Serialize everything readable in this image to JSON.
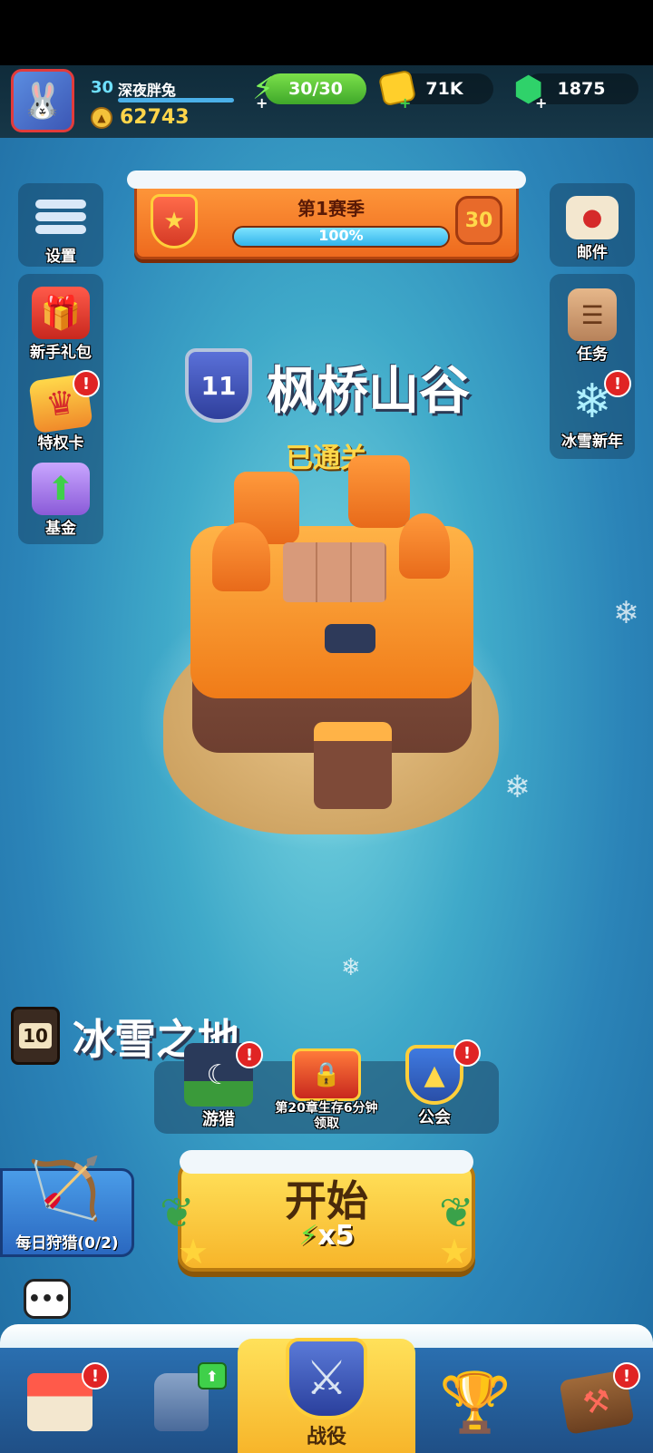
{
  "player": {
    "level": "30",
    "name": "深夜胖兔",
    "coins": "62743"
  },
  "resources": {
    "energy": "30/30",
    "gold": "71K",
    "gems": "1875"
  },
  "season": {
    "title": "第1赛季",
    "progress_text": "100%",
    "progress": 1.0,
    "level": "30"
  },
  "left_menu": [
    {
      "label": "设置",
      "icon": "menu-icon"
    },
    {
      "label": "新手礼包",
      "icon": "gift-icon"
    },
    {
      "label": "特权卡",
      "icon": "card-icon"
    },
    {
      "label": "基金",
      "icon": "chest-icon"
    }
  ],
  "right_menu": [
    {
      "label": "邮件",
      "icon": "mail-icon"
    },
    {
      "label": "任务",
      "icon": "clipboard-icon"
    },
    {
      "label": "冰雪新年",
      "icon": "snowflake-icon"
    }
  ],
  "chapter": {
    "number": "11",
    "name": "枫桥山谷",
    "status": "已通关"
  },
  "next_chapter": {
    "number": "10",
    "name": "冰雪之地"
  },
  "quick": [
    {
      "label": "游猎",
      "icon": "hunt-icon"
    },
    {
      "label": "第20章生存6分钟领取",
      "icon": "treasure-chest-icon"
    },
    {
      "label": "公会",
      "icon": "guild-icon"
    }
  ],
  "daily_hunt": {
    "label": "每日狩猎(0/2)"
  },
  "start": {
    "label": "开始",
    "cost": "x5"
  },
  "badge_symbol": "!",
  "nav": [
    {
      "name": "shop",
      "icon": "shop-icon"
    },
    {
      "name": "equipment",
      "icon": "armor-icon"
    },
    {
      "name": "campaign",
      "label": "战役",
      "icon": "crossed-swords-icon"
    },
    {
      "name": "trophy",
      "icon": "trophy-icon"
    },
    {
      "name": "talent",
      "icon": "hammer-icon"
    }
  ],
  "colors": {
    "accent_yellow": "#ffd84a",
    "energy_green": "#3fa82a",
    "badge_red": "#e02424"
  }
}
